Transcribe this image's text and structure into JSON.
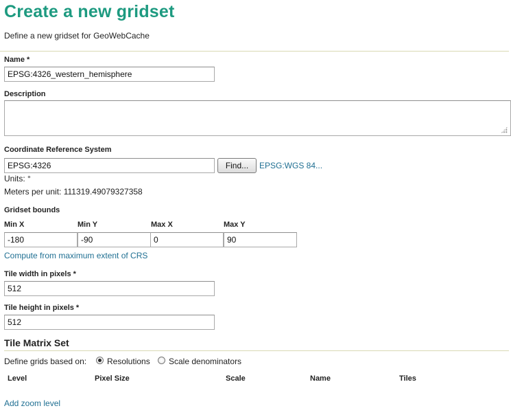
{
  "header": {
    "title": "Create a new gridset",
    "subtitle": "Define a new gridset for GeoWebCache"
  },
  "name_field": {
    "label": "Name *",
    "value": "EPSG:4326_western_hemisphere"
  },
  "description_field": {
    "label": "Description",
    "value": ""
  },
  "crs": {
    "label": "Coordinate Reference System",
    "value": "EPSG:4326",
    "find_button": "Find...",
    "crs_link": "EPSG:WGS 84...",
    "units": "Units: °",
    "meters_per_unit": "Meters per unit: 111319.49079327358"
  },
  "bounds": {
    "label": "Gridset bounds",
    "min_x_label": "Min X",
    "min_y_label": "Min Y",
    "max_x_label": "Max X",
    "max_y_label": "Max Y",
    "min_x": "-180",
    "min_y": "-90",
    "max_x": "0",
    "max_y": "90",
    "compute_link": "Compute from maximum extent of CRS"
  },
  "tile_width": {
    "label": "Tile width in pixels *",
    "value": "512"
  },
  "tile_height": {
    "label": "Tile height in pixels *",
    "value": "512"
  },
  "matrix": {
    "title": "Tile Matrix Set",
    "define_label": "Define grids based on:",
    "option_resolutions": "Resolutions",
    "option_scale": "Scale denominators",
    "selected_option": "Resolutions",
    "columns": [
      "Level",
      "Pixel Size",
      "Scale",
      "Name",
      "Tiles"
    ],
    "add_link": "Add zoom level"
  }
}
